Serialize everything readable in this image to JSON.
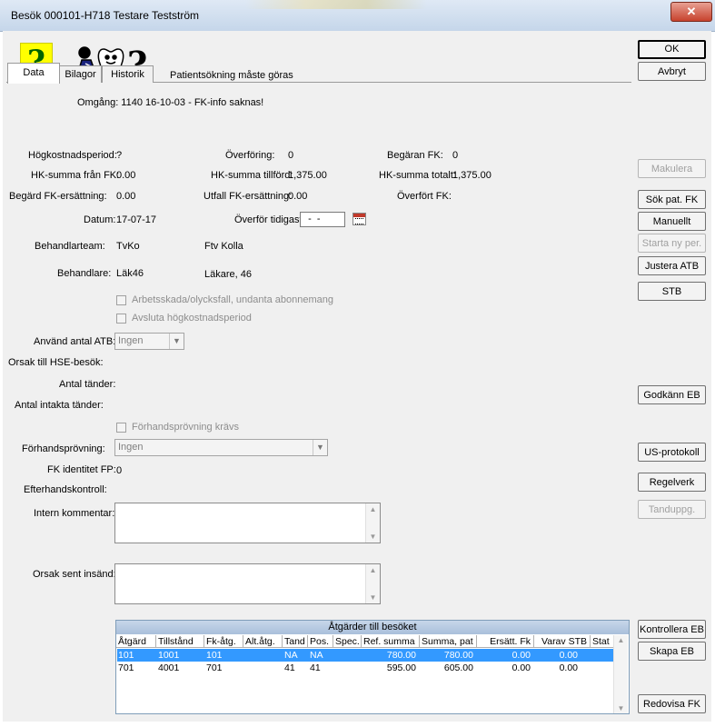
{
  "window": {
    "title": "Besök 000101-H718 Testare Testström",
    "close_glyph": "✕"
  },
  "header": {
    "message": "Patientsökning måste göras",
    "question_mark": "?"
  },
  "tabs": [
    {
      "label": "Data"
    },
    {
      "label": "Bilagor"
    },
    {
      "label": "Historik"
    }
  ],
  "fields": {
    "omgang_label": "Omgång:",
    "omgang_value": "Omgång: 1140 16-10-03 -  FK-info saknas!",
    "hogkost_label": "Högkostnadsperiod:",
    "hogkost_value": "?",
    "overforing_label": "Överföring:",
    "overforing_value": "0",
    "begaran_label": "Begäran FK:",
    "begaran_value": "0",
    "hk_fran_label": "HK-summa från FK:",
    "hk_fran_value": "0.00",
    "hk_tillford_label": "HK-summa tillförd:",
    "hk_tillford_value": "1,375.00",
    "hk_totalt_label": "HK-summa totalt:",
    "hk_totalt_value": "1,375.00",
    "begard_label": "Begärd FK-ersättning:",
    "begard_value": "0.00",
    "utfall_label": "Utfall FK-ersättning:",
    "utfall_value": "0.00",
    "overfort_label": "Överfört FK:",
    "overfort_value": "",
    "datum_label": "Datum:",
    "datum_value": "17-07-17",
    "overfor_tidigast_label": "Överför tidigast:",
    "overfor_tidigast_value": "  -  -",
    "team_label": "Behandlarteam:",
    "team_code": "TvKo",
    "team_name": "Ftv Kolla",
    "behandlare_label": "Behandlare:",
    "behandlare_code": "Läk46",
    "behandlare_name": "Läkare, 46",
    "chk_arbetsskada": "Arbetsskada/olycksfall, undanta abonnemang",
    "chk_avsluta": "Avsluta högkostnadsperiod",
    "atb_label": "Använd antal ATB:",
    "atb_value": "Ingen",
    "hse_label": "Orsak till HSE-besök:",
    "tander_label": "Antal tänder:",
    "intakta_label": "Antal intakta tänder:",
    "chk_forhand": "Förhandsprövning krävs",
    "forhand_label": "Förhandsprövning:",
    "forhand_value": "Ingen",
    "fk_id_label": "FK identitet FP:",
    "fk_id_value": "0",
    "efterhand_label": "Efterhandskontroll:",
    "intern_label": "Intern kommentar:",
    "orsak_sent_label": "Orsak sent insänd:"
  },
  "buttons": {
    "ok": "OK",
    "avbryt": "Avbryt",
    "makulera": "Makulera",
    "sok_pat": "Sök pat. FK",
    "manuellt": "Manuellt",
    "starta": "Starta ny per.",
    "justera": "Justera ATB",
    "stb": "STB",
    "godkann": "Godkänn EB",
    "us": "US-protokoll",
    "regelverk": "Regelverk",
    "tanduppg": "Tanduppg.",
    "kontrollera": "Kontrollera EB",
    "skapa": "Skapa EB",
    "redovisa": "Redovisa FK"
  },
  "table": {
    "title": "Åtgärder till besöket",
    "columns": [
      "Åtgärd",
      "Tillstånd",
      "Fk-åtg.",
      "Alt.åtg.",
      "Tand",
      "Pos.",
      "Spec.",
      "Ref. summa",
      "Summa, pat",
      "Ersätt. Fk",
      "Varav STB",
      "Stat"
    ],
    "rows": [
      [
        "101",
        "1001",
        "101",
        "",
        "NA",
        "NA",
        "",
        "780.00",
        "780.00",
        "0.00",
        "0.00",
        ""
      ],
      [
        "701",
        "4001",
        "701",
        "",
        "41",
        "41",
        "",
        "595.00",
        "605.00",
        "0.00",
        "0.00",
        ""
      ]
    ]
  }
}
